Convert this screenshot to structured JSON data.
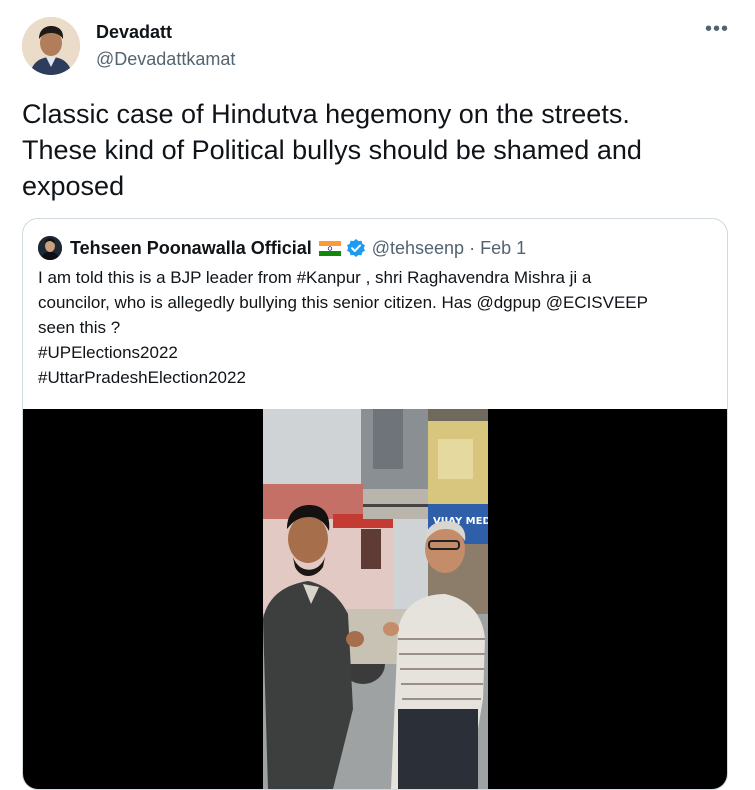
{
  "tweet": {
    "author_name": "Devadatt",
    "author_handle": "@Devadattkamat",
    "more_label": "•••",
    "text_lines": [
      "Classic case of Hindutva hegemony  on the streets.",
      "These kind of Political bullys should be shamed and",
      "exposed"
    ]
  },
  "quoted": {
    "author_name": "Tehseen Poonawalla Official",
    "handle_date": "@tehseenp · Feb 1",
    "text_lines": [
      "I am told this is a BJP leader from #Kanpur , shri Raghavendra Mishra ji a",
      "councilor, who is allegedly bullying this  senior citizen. Has @dgpup @ECISVEEP",
      "seen this ?",
      "#UPElections2022",
      "#UttarPradeshElection2022"
    ],
    "media": {
      "shop_sign": "VIJAY MED"
    }
  },
  "icons": {
    "flag": "india-flag-icon",
    "verified": "verified-badge-icon",
    "more": "more-icon"
  },
  "colors": {
    "text": "#0f1419",
    "secondary": "#536471",
    "verified": "#1d9bf0",
    "border": "#cfd9de"
  }
}
